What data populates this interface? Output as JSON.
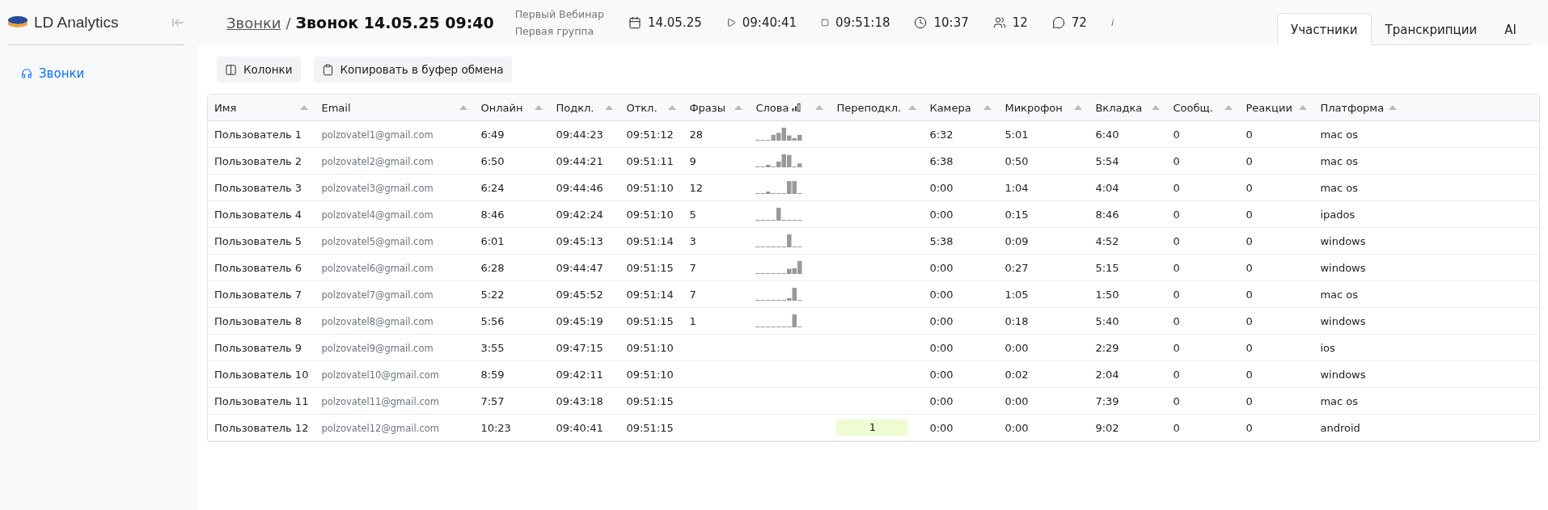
{
  "app": {
    "name": "LD Analytics"
  },
  "sidebar": {
    "items": [
      {
        "label": "Звонки",
        "selected": true
      }
    ]
  },
  "header": {
    "breadcrumb": "Звонки",
    "separator": "/",
    "title": "Звонок 14.05.25 09:40",
    "webinar": "Первый Вебинар",
    "group": "Первая группа",
    "stats": [
      {
        "kind": "date",
        "value": "14.05.25"
      },
      {
        "kind": "start",
        "value": "09:40:41"
      },
      {
        "kind": "end",
        "value": "09:51:18"
      },
      {
        "kind": "duration",
        "value": "10:37"
      },
      {
        "kind": "participants",
        "value": "12"
      },
      {
        "kind": "messages",
        "value": "72"
      }
    ],
    "info": "i"
  },
  "tabs": [
    {
      "label": "Участники",
      "selected": true
    },
    {
      "label": "Транскрипции",
      "selected": false
    },
    {
      "label": "AI",
      "selected": false
    }
  ],
  "toolbar": {
    "buttons": [
      {
        "kind": "columns",
        "label": "Колонки"
      },
      {
        "kind": "copy",
        "label": "Копировать в буфер обмена"
      }
    ]
  },
  "table": {
    "columns": [
      "Имя",
      "Email",
      "Онлайн",
      "Подкл.",
      "Откл.",
      "Фразы",
      "Слова",
      "Переподкл.",
      "Камера",
      "Микрофон",
      "Вкладка",
      "Сообщ.",
      "Реакции",
      "Платформа"
    ],
    "rows": [
      {
        "name": "Пользователь 1",
        "email": "polzovatel1@gmail.com",
        "online": "6:49",
        "connected": "09:44:23",
        "disconnected": "09:51:12",
        "phrases": "28",
        "camera": "6:32",
        "mic": "5:01",
        "tab": "6:40",
        "messages": "0",
        "reactions": "0",
        "platform": "mac os"
      },
      {
        "name": "Пользователь 2",
        "email": "polzovatel2@gmail.com",
        "online": "6:50",
        "connected": "09:44:21",
        "disconnected": "09:51:11",
        "phrases": "9",
        "camera": "6:38",
        "mic": "0:50",
        "tab": "5:54",
        "messages": "0",
        "reactions": "0",
        "platform": "mac os"
      },
      {
        "name": "Пользователь 3",
        "email": "polzovatel3@gmail.com",
        "online": "6:24",
        "connected": "09:44:46",
        "disconnected": "09:51:10",
        "phrases": "12",
        "camera": "0:00",
        "mic": "1:04",
        "tab": "4:04",
        "messages": "0",
        "reactions": "0",
        "platform": "mac os"
      },
      {
        "name": "Пользователь 4",
        "email": "polzovatel4@gmail.com",
        "online": "8:46",
        "connected": "09:42:24",
        "disconnected": "09:51:10",
        "phrases": "5",
        "camera": "0:00",
        "mic": "0:15",
        "tab": "8:46",
        "messages": "0",
        "reactions": "0",
        "platform": "ipados"
      },
      {
        "name": "Пользователь 5",
        "email": "polzovatel5@gmail.com",
        "online": "6:01",
        "connected": "09:45:13",
        "disconnected": "09:51:14",
        "phrases": "3",
        "camera": "5:38",
        "mic": "0:09",
        "tab": "4:52",
        "messages": "0",
        "reactions": "0",
        "platform": "windows"
      },
      {
        "name": "Пользователь 6",
        "email": "polzovatel6@gmail.com",
        "online": "6:28",
        "connected": "09:44:47",
        "disconnected": "09:51:15",
        "phrases": "7",
        "camera": "0:00",
        "mic": "0:27",
        "tab": "5:15",
        "messages": "0",
        "reactions": "0",
        "platform": "windows"
      },
      {
        "name": "Пользователь 7",
        "email": "polzovatel7@gmail.com",
        "online": "5:22",
        "connected": "09:45:52",
        "disconnected": "09:51:14",
        "phrases": "7",
        "camera": "0:00",
        "mic": "1:05",
        "tab": "1:50",
        "messages": "0",
        "reactions": "0",
        "platform": "mac os"
      },
      {
        "name": "Пользователь 8",
        "email": "polzovatel8@gmail.com",
        "online": "5:56",
        "connected": "09:45:19",
        "disconnected": "09:51:15",
        "phrases": "1",
        "camera": "0:00",
        "mic": "0:18",
        "tab": "5:40",
        "messages": "0",
        "reactions": "0",
        "platform": "windows"
      },
      {
        "name": "Пользователь 9",
        "email": "polzovatel9@gmail.com",
        "online": "3:55",
        "connected": "09:47:15",
        "disconnected": "09:51:10",
        "camera": "0:00",
        "mic": "0:00",
        "tab": "2:29",
        "messages": "0",
        "reactions": "0",
        "platform": "ios"
      },
      {
        "name": "Пользователь 10",
        "email": "polzovatel10@gmail.com",
        "online": "8:59",
        "connected": "09:42:11",
        "disconnected": "09:51:10",
        "camera": "0:00",
        "mic": "0:02",
        "tab": "2:04",
        "messages": "0",
        "reactions": "0",
        "platform": "windows"
      },
      {
        "name": "Пользователь 11",
        "email": "polzovatel11@gmail.com",
        "online": "7:57",
        "connected": "09:43:18",
        "disconnected": "09:51:15",
        "camera": "0:00",
        "mic": "0:00",
        "tab": "7:39",
        "messages": "0",
        "reactions": "0",
        "platform": "mac os"
      },
      {
        "name": "Пользователь 12",
        "email": "polzovatel12@gmail.com",
        "online": "10:23",
        "connected": "09:40:41",
        "disconnected": "09:51:15",
        "reconnects": "1",
        "camera": "0:00",
        "mic": "0:00",
        "tab": "9:02",
        "messages": "0",
        "reactions": "0",
        "platform": "android"
      }
    ]
  }
}
